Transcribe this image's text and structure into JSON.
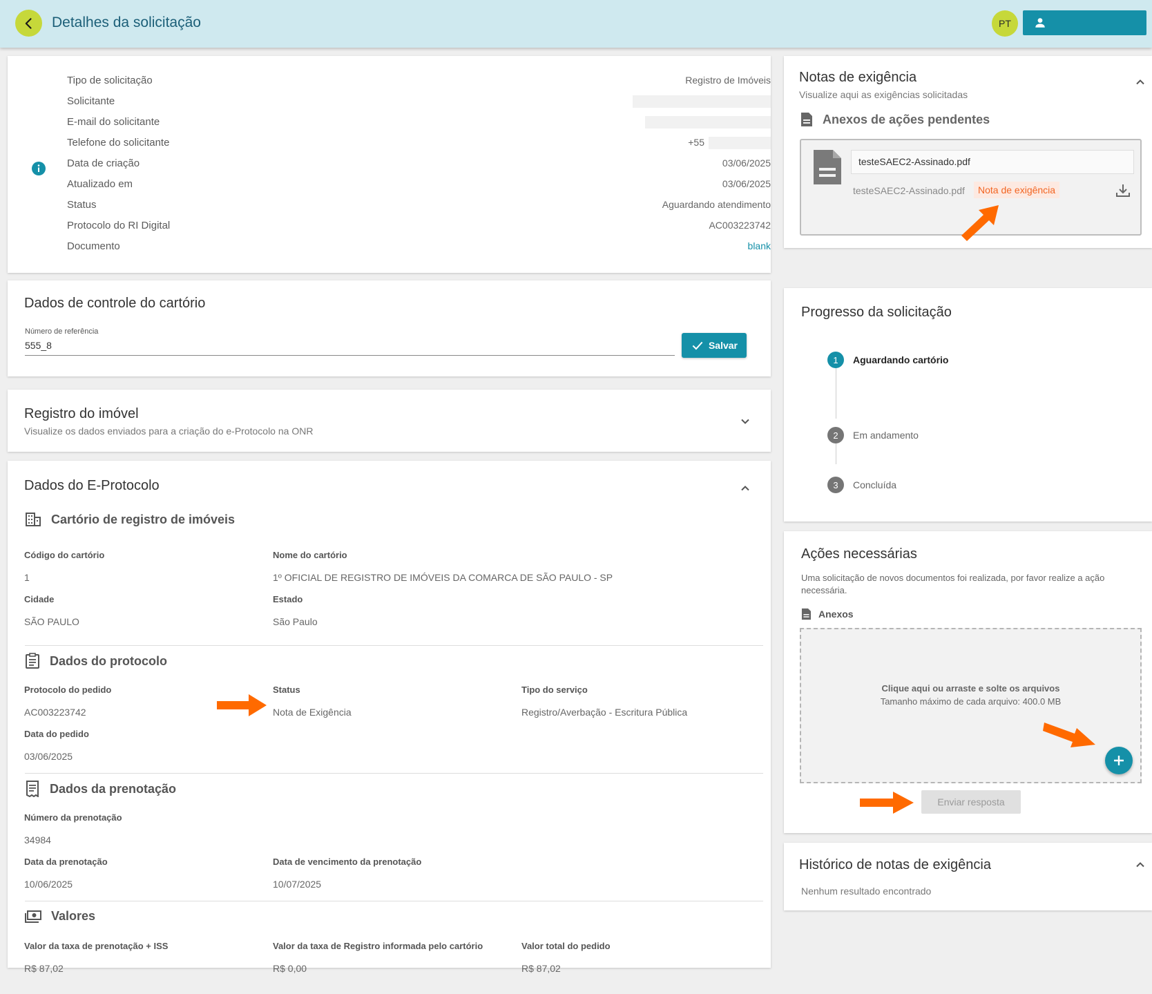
{
  "header": {
    "title": "Detalhes da solicitação",
    "language": "PT",
    "user_button_label": ""
  },
  "info": {
    "rows": [
      {
        "label": "Tipo de solicitação",
        "value": "Registro de Imóveis"
      },
      {
        "label": "Solicitante",
        "value": ""
      },
      {
        "label": "E-mail do solicitante",
        "value": ""
      },
      {
        "label": "Telefone do solicitante",
        "value": "+55"
      },
      {
        "label": "Data de criação",
        "value": "03/06/2025"
      },
      {
        "label": "Atualizado em",
        "value": "03/06/2025"
      },
      {
        "label": "Status",
        "value": "Aguardando atendimento"
      },
      {
        "label": "Protocolo do RI Digital",
        "value": "AC003223742"
      },
      {
        "label": "Documento",
        "value": "blank"
      }
    ]
  },
  "control": {
    "title": "Dados de controle do cartório",
    "field_label": "Número de referência",
    "field_value": "555_8",
    "save_label": "Salvar"
  },
  "registro": {
    "title": "Registro do imóvel",
    "subtitle": "Visualize os dados enviados para a criação do e-Protocolo na ONR"
  },
  "eprotocolo": {
    "title": "Dados do E-Protocolo",
    "cartorio": {
      "heading": "Cartório de registro de imóveis",
      "codigo_label": "Código do cartório",
      "codigo_value": "1",
      "nome_label": "Nome do cartório",
      "nome_value": "1º OFICIAL DE REGISTRO DE IMÓVEIS DA COMARCA DE SÃO PAULO - SP",
      "cidade_label": "Cidade",
      "cidade_value": "SÃO PAULO",
      "estado_label": "Estado",
      "estado_value": "São Paulo"
    },
    "protocolo": {
      "heading": "Dados do protocolo",
      "pedido_label": "Protocolo do pedido",
      "pedido_value": "AC003223742",
      "status_label": "Status",
      "status_value": "Nota de Exigência",
      "servico_label": "Tipo do serviço",
      "servico_value": "Registro/Averbação - Escritura Pública",
      "data_label": "Data do pedido",
      "data_value": "03/06/2025"
    },
    "prenotacao": {
      "heading": "Dados da prenotação",
      "numero_label": "Número da prenotação",
      "numero_value": "34984",
      "data_label": "Data da prenotação",
      "data_value": "10/06/2025",
      "venc_label": "Data de vencimento da prenotação",
      "venc_value": "10/07/2025"
    },
    "valores": {
      "heading": "Valores",
      "taxa_label": "Valor da taxa de prenotação + ISS",
      "taxa_value": "R$ 87,02",
      "registro_label": "Valor da taxa de Registro informada pelo cartório",
      "registro_value": "R$ 0,00",
      "total_label": "Valor total do pedido",
      "total_value": "R$ 87,02"
    }
  },
  "notas": {
    "title": "Notas de exigência",
    "subtitle": "Visualize aqui as exigências solicitadas",
    "anexos_heading": "Anexos de ações pendentes",
    "file_input_value": "testeSAEC2-Assinado.pdf",
    "file_name": "testeSAEC2-Assinado.pdf",
    "tag": "Nota de exigência"
  },
  "progresso": {
    "title": "Progresso da solicitação",
    "steps": [
      {
        "num": "1",
        "label": "Aguardando cartório"
      },
      {
        "num": "2",
        "label": "Em andamento"
      },
      {
        "num": "3",
        "label": "Concluída"
      }
    ]
  },
  "acoes": {
    "title": "Ações necessárias",
    "description_line1": "Uma solicitação de novos documentos foi realizada, por favor realize a ação",
    "description_line2": "necessária.",
    "anexos_label": "Anexos",
    "drop_line1": "Clique aqui ou arraste e solte os arquivos",
    "drop_line2": "Tamanho máximo de cada arquivo: 400.0 MB",
    "send_label": "Enviar resposta"
  },
  "historico": {
    "title": "Histórico de notas de exigência",
    "empty": "Nenhum resultado encontrado"
  },
  "colors": {
    "accent": "#1590a8",
    "brand_yellow": "#c6d83a",
    "header_bg": "#cfe9ef",
    "annotation_arrow": "#ff6a00",
    "tag_text": "#f26522"
  }
}
